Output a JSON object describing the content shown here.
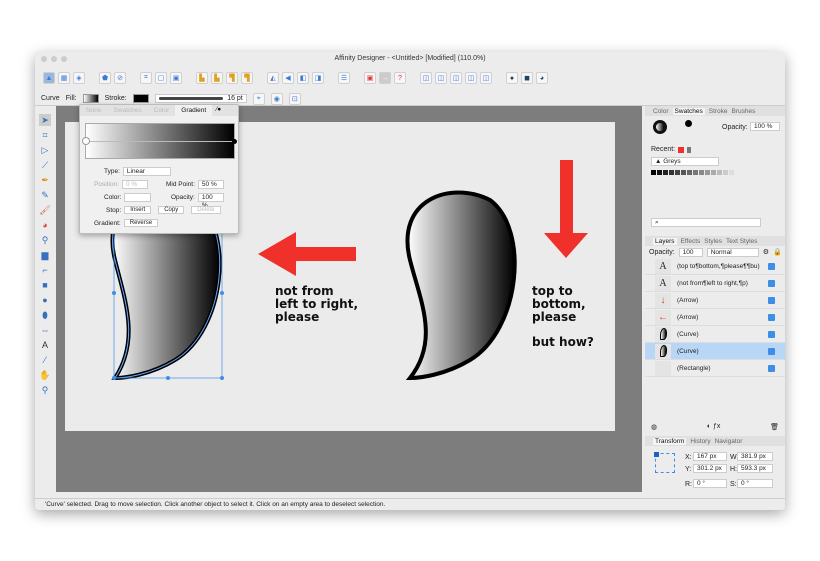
{
  "window": {
    "title": "Affinity Designer - <Untitled> [Modified] (110.0%)"
  },
  "context": {
    "tool": "Curve",
    "fill_label": "Fill:",
    "stroke_label": "Stroke:",
    "stroke_width": "16 pt"
  },
  "popover": {
    "tabs": [
      "None",
      "Swatches",
      "Color",
      "Gradient"
    ],
    "active_tab": "Gradient",
    "type_label": "Type:",
    "type_value": "Linear",
    "position_label": "Position:",
    "position_value": "0 %",
    "midpoint_label": "Mid Point:",
    "midpoint_value": "50 %",
    "color_label": "Color:",
    "opacity_label": "Opacity:",
    "opacity_value": "100 %",
    "stop_label": "Stop:",
    "insert": "Insert",
    "copy": "Copy",
    "delete": "Delete",
    "gradient_label": "Gradient:",
    "reverse": "Reverse"
  },
  "canvas": {
    "text_left": [
      "not from",
      "left to right,",
      "please"
    ],
    "text_right": [
      "top to",
      "bottom,",
      "please"
    ],
    "text_right2": "but how?",
    "arrow_color": "#f0302a"
  },
  "swatches_panel": {
    "tabs": [
      "Color",
      "Swatches",
      "Stroke",
      "Brushes"
    ],
    "active": "Swatches",
    "opacity_label": "Opacity:",
    "opacity_value": "100 %",
    "recent_label": "Recent:",
    "palette": "Greys"
  },
  "layers_panel": {
    "tabs": [
      "Layers",
      "Effects",
      "Styles",
      "Text Styles"
    ],
    "active": "Layers",
    "opacity_label": "Opacity:",
    "opacity_value": "100",
    "blend_mode": "Normal",
    "layers": [
      {
        "name": "(top to¶bottom,¶please¶¶bu)",
        "thumb": "A",
        "selected": false
      },
      {
        "name": "(not from¶left to right,¶p)",
        "thumb": "A",
        "selected": false
      },
      {
        "name": "(Arrow)",
        "thumb": "arrow-down",
        "selected": false
      },
      {
        "name": "(Arrow)",
        "thumb": "arrow-left",
        "selected": false
      },
      {
        "name": "(Curve)",
        "thumb": "curve",
        "selected": false
      },
      {
        "name": "(Curve)",
        "thumb": "curve",
        "selected": true
      },
      {
        "name": "(Rectangle)",
        "thumb": "rect",
        "selected": false
      }
    ]
  },
  "transform_panel": {
    "tabs": [
      "Transform",
      "History",
      "Navigator"
    ],
    "active": "Transform",
    "x_label": "X:",
    "x": "167 px",
    "y_label": "Y:",
    "y": "301.2 px",
    "w_label": "W:",
    "w": "381.9 px",
    "h_label": "H:",
    "h": "593.3 px",
    "r_label": "R:",
    "r": "0 °",
    "s_label": "S:",
    "s": "0 °"
  },
  "status": "'Curve' selected. Drag to move selection. Click another object to select it. Click on an empty area to deselect selection."
}
